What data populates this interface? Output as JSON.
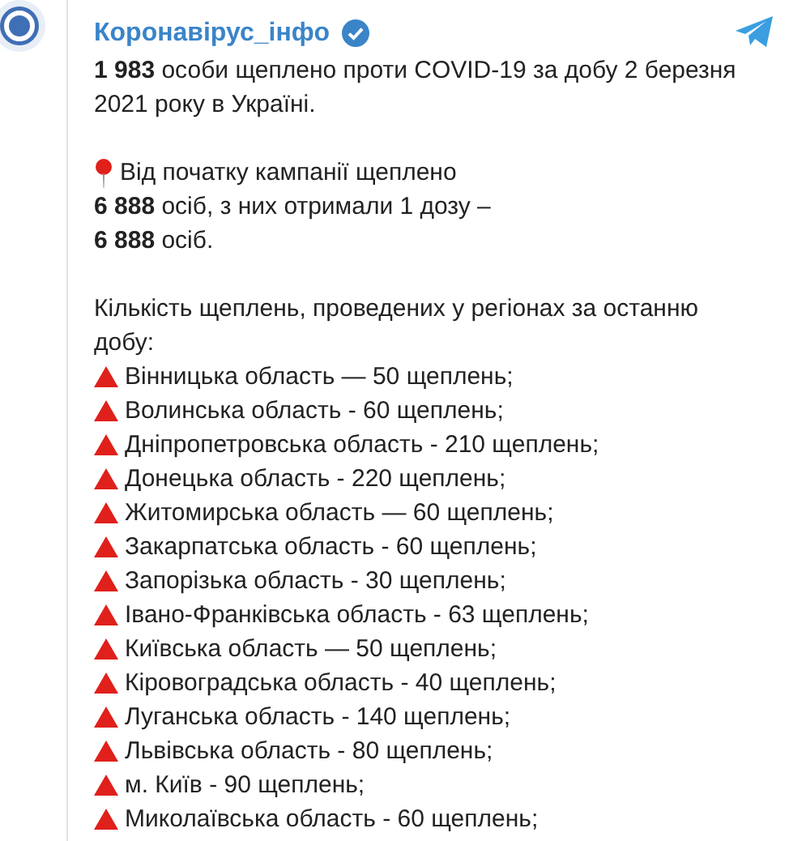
{
  "channel": {
    "name": "Коронавірус_інфо",
    "verified": true
  },
  "post": {
    "intro": [
      "**1 983** особи щеплено проти COVID-19 за добу 2 березня",
      "2021 року в Україні."
    ],
    "campaign": [
      "Від початку кампанії щеплено",
      "**6 888** осіб, з них отримали 1 дозу –",
      "**6 888** осіб."
    ],
    "regions_heading": [
      "Кількість щеплень, проведених у регіонах за останню",
      "добу:"
    ],
    "regions": [
      "Вінницька область — 50 щеплень;",
      "Волинська область - 60 щеплень;",
      "Дніпропетровська область - 210 щеплень;",
      "Донецька область - 220 щеплень;",
      "Житомирська область — 60 щеплень;",
      "Закарпатська область - 60 щеплень;",
      "Запорізька область - 30 щеплень;",
      "Івано-Франківська область - 63 щеплень;",
      "Київська область — 50 щеплень;",
      "Кіровоградська область - 40 щеплень;",
      "Луганська область - 140 щеплень;",
      "Львівська область - 80 щеплень;",
      "м. Київ - 90 щеплень;",
      "Миколаївська область - 60 щеплень;"
    ]
  }
}
